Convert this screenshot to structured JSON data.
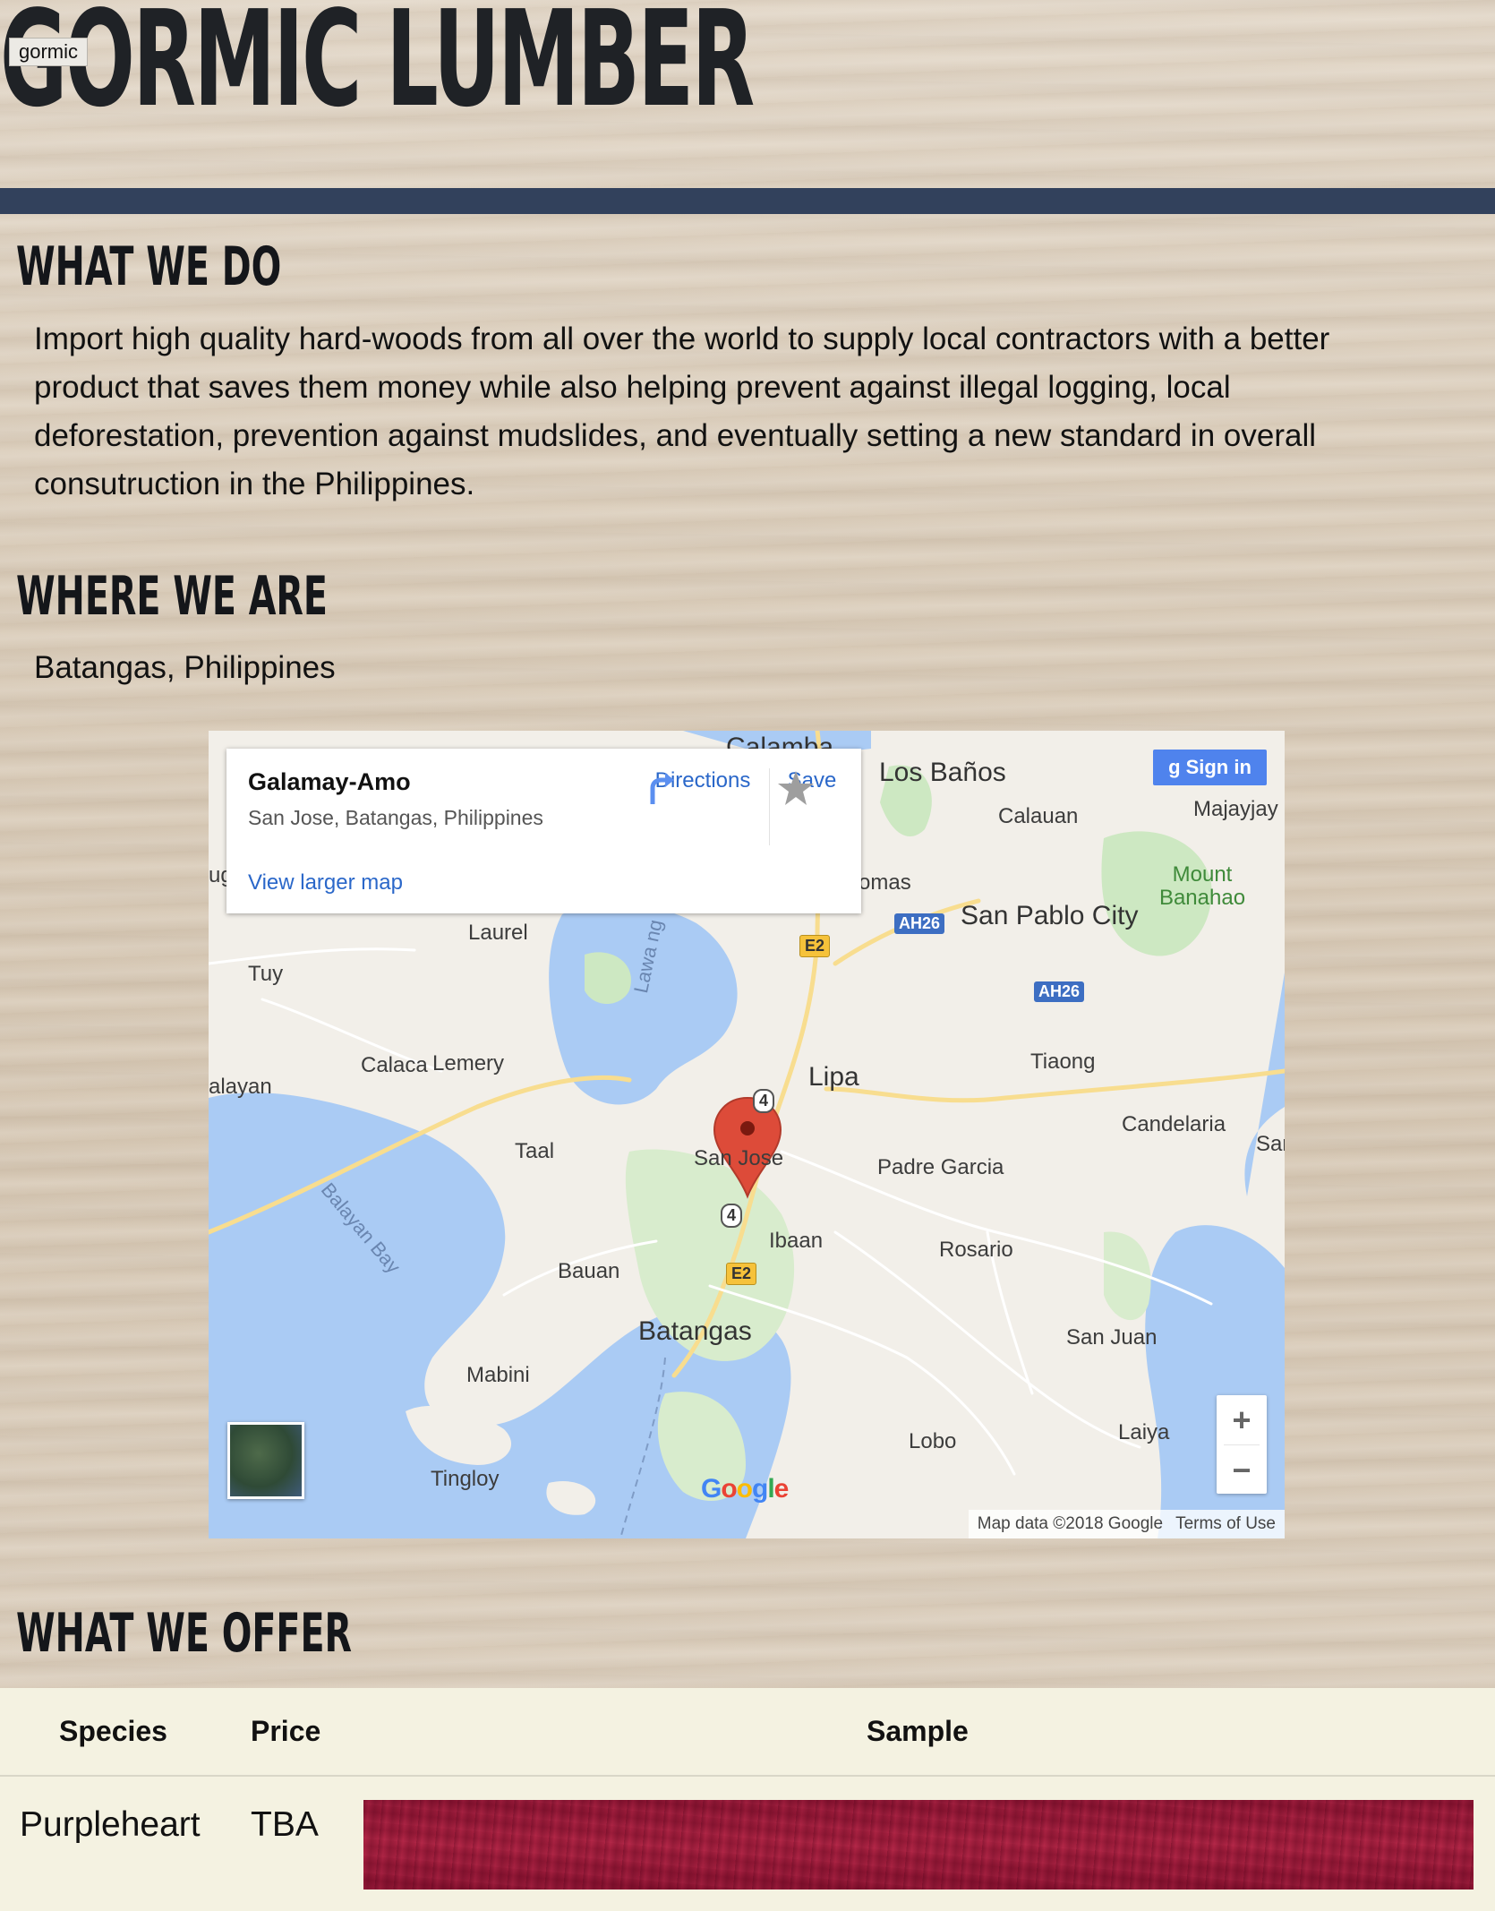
{
  "site": {
    "name": "GORMIC LUMBER",
    "tag": "gormic"
  },
  "sections": {
    "what_we_do": {
      "heading": "WHAT WE DO",
      "body": "Import high quality hard-woods from all over the world to supply local contractors with a better product that saves them money while also helping prevent against illegal logging, local deforestation, prevention against mudslides, and eventually setting a new standard in overall consutruction in the Philippines."
    },
    "where_we_are": {
      "heading": "WHERE WE ARE",
      "location": "Batangas, Philippines"
    },
    "what_we_offer": {
      "heading": "WHAT WE OFFER"
    }
  },
  "map": {
    "place_name": "Galamay-Amo",
    "place_address": "San Jose, Batangas, Philippines",
    "directions_label": "Directions",
    "save_label": "Save",
    "view_larger_label": "View larger map",
    "sign_in_label": "Sign in",
    "attribution": "Map data ©2018 Google",
    "terms": "Terms of Use",
    "logo": "Google",
    "zoom_in": "+",
    "zoom_out": "−",
    "labels": {
      "colombo": "Calamba",
      "los_banos": "Los Baños",
      "calauan": "Calauan",
      "majayjay": "Majayjay",
      "mount_banahao": "Mount Banahao",
      "tomas": "omas",
      "san_pablo": "San Pablo City",
      "laurel": "Laurel",
      "tuy": "Tuy",
      "lawa": "Lawa ng Taal",
      "tiaong": "Tiaong",
      "calaca": "Calaca",
      "lemery": "Lemery",
      "lipa": "Lipa",
      "balayan": "alayan",
      "candelaria": "Candelaria",
      "san_east": "Sar",
      "taal": "Taal",
      "san_jose": "San Jose",
      "padre_garcia": "Padre Garcia",
      "balayan_bay": "Balayan Bay",
      "ibaan": "Ibaan",
      "rosario": "Rosario",
      "bauan": "Bauan",
      "batangas": "Batangas",
      "san_juan": "San Juan",
      "mabini": "Mabini",
      "lobo": "Lobo",
      "laiya": "Laiya",
      "tingloy": "Tingloy",
      "ug": "ug",
      "ah26_a": "AH26",
      "ah26_b": "AH26",
      "e2_a": "E2",
      "e2_b": "E2",
      "r4_a": "4",
      "r4_b": "4"
    }
  },
  "table": {
    "headers": [
      "Species",
      "Price",
      "Sample"
    ],
    "rows": [
      {
        "species": "Purpleheart",
        "price": "TBA"
      }
    ]
  },
  "colors": {
    "nav_bar": "#32415c",
    "table_bg": "#f4f2e1",
    "link_blue": "#2a67c9",
    "sample": "#a8203f"
  },
  "icons": [
    "directions-icon",
    "star-icon",
    "google-plus-icon",
    "map-pin-icon"
  ]
}
